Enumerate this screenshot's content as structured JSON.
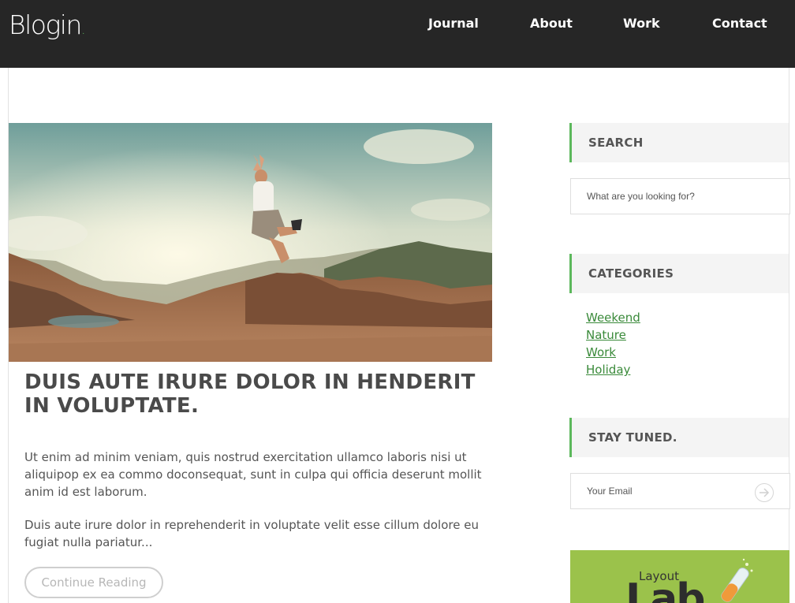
{
  "header": {
    "logo": "Blogin",
    "logo_dot": ".",
    "nav": [
      "Journal",
      "About",
      "Work",
      "Contact"
    ]
  },
  "post": {
    "title": "DUIS AUTE IRURE DOLOR IN HENDERIT IN VOLUPTATE.",
    "paragraph_1": "Ut enim ad minim veniam, quis nostrud exercitation ullamco laboris nisi ut aliquipop ex ea commo doconsequat, sunt in culpa qui officia deserunt mollit anim id est laborum.",
    "paragraph_2": "Duis aute irure dolor in reprehenderit in voluptate velit esse cillum dolore eu fugiat nulla pariatur...",
    "continue_label": "Continue Reading"
  },
  "sidebar": {
    "search": {
      "heading": "SEARCH",
      "placeholder": "What are you looking for?"
    },
    "categories": {
      "heading": "CATEGORIES",
      "items": [
        "Weekend",
        "Nature",
        "Work",
        "Holiday"
      ]
    },
    "newsletter": {
      "heading": "STAY TUNED.",
      "placeholder": "Your Email"
    },
    "ad": {
      "text": "Layout",
      "text_big": "Lab"
    }
  },
  "colors": {
    "header_bg": "#262626",
    "accent": "#5cb85c",
    "link": "#3a8a3a"
  }
}
